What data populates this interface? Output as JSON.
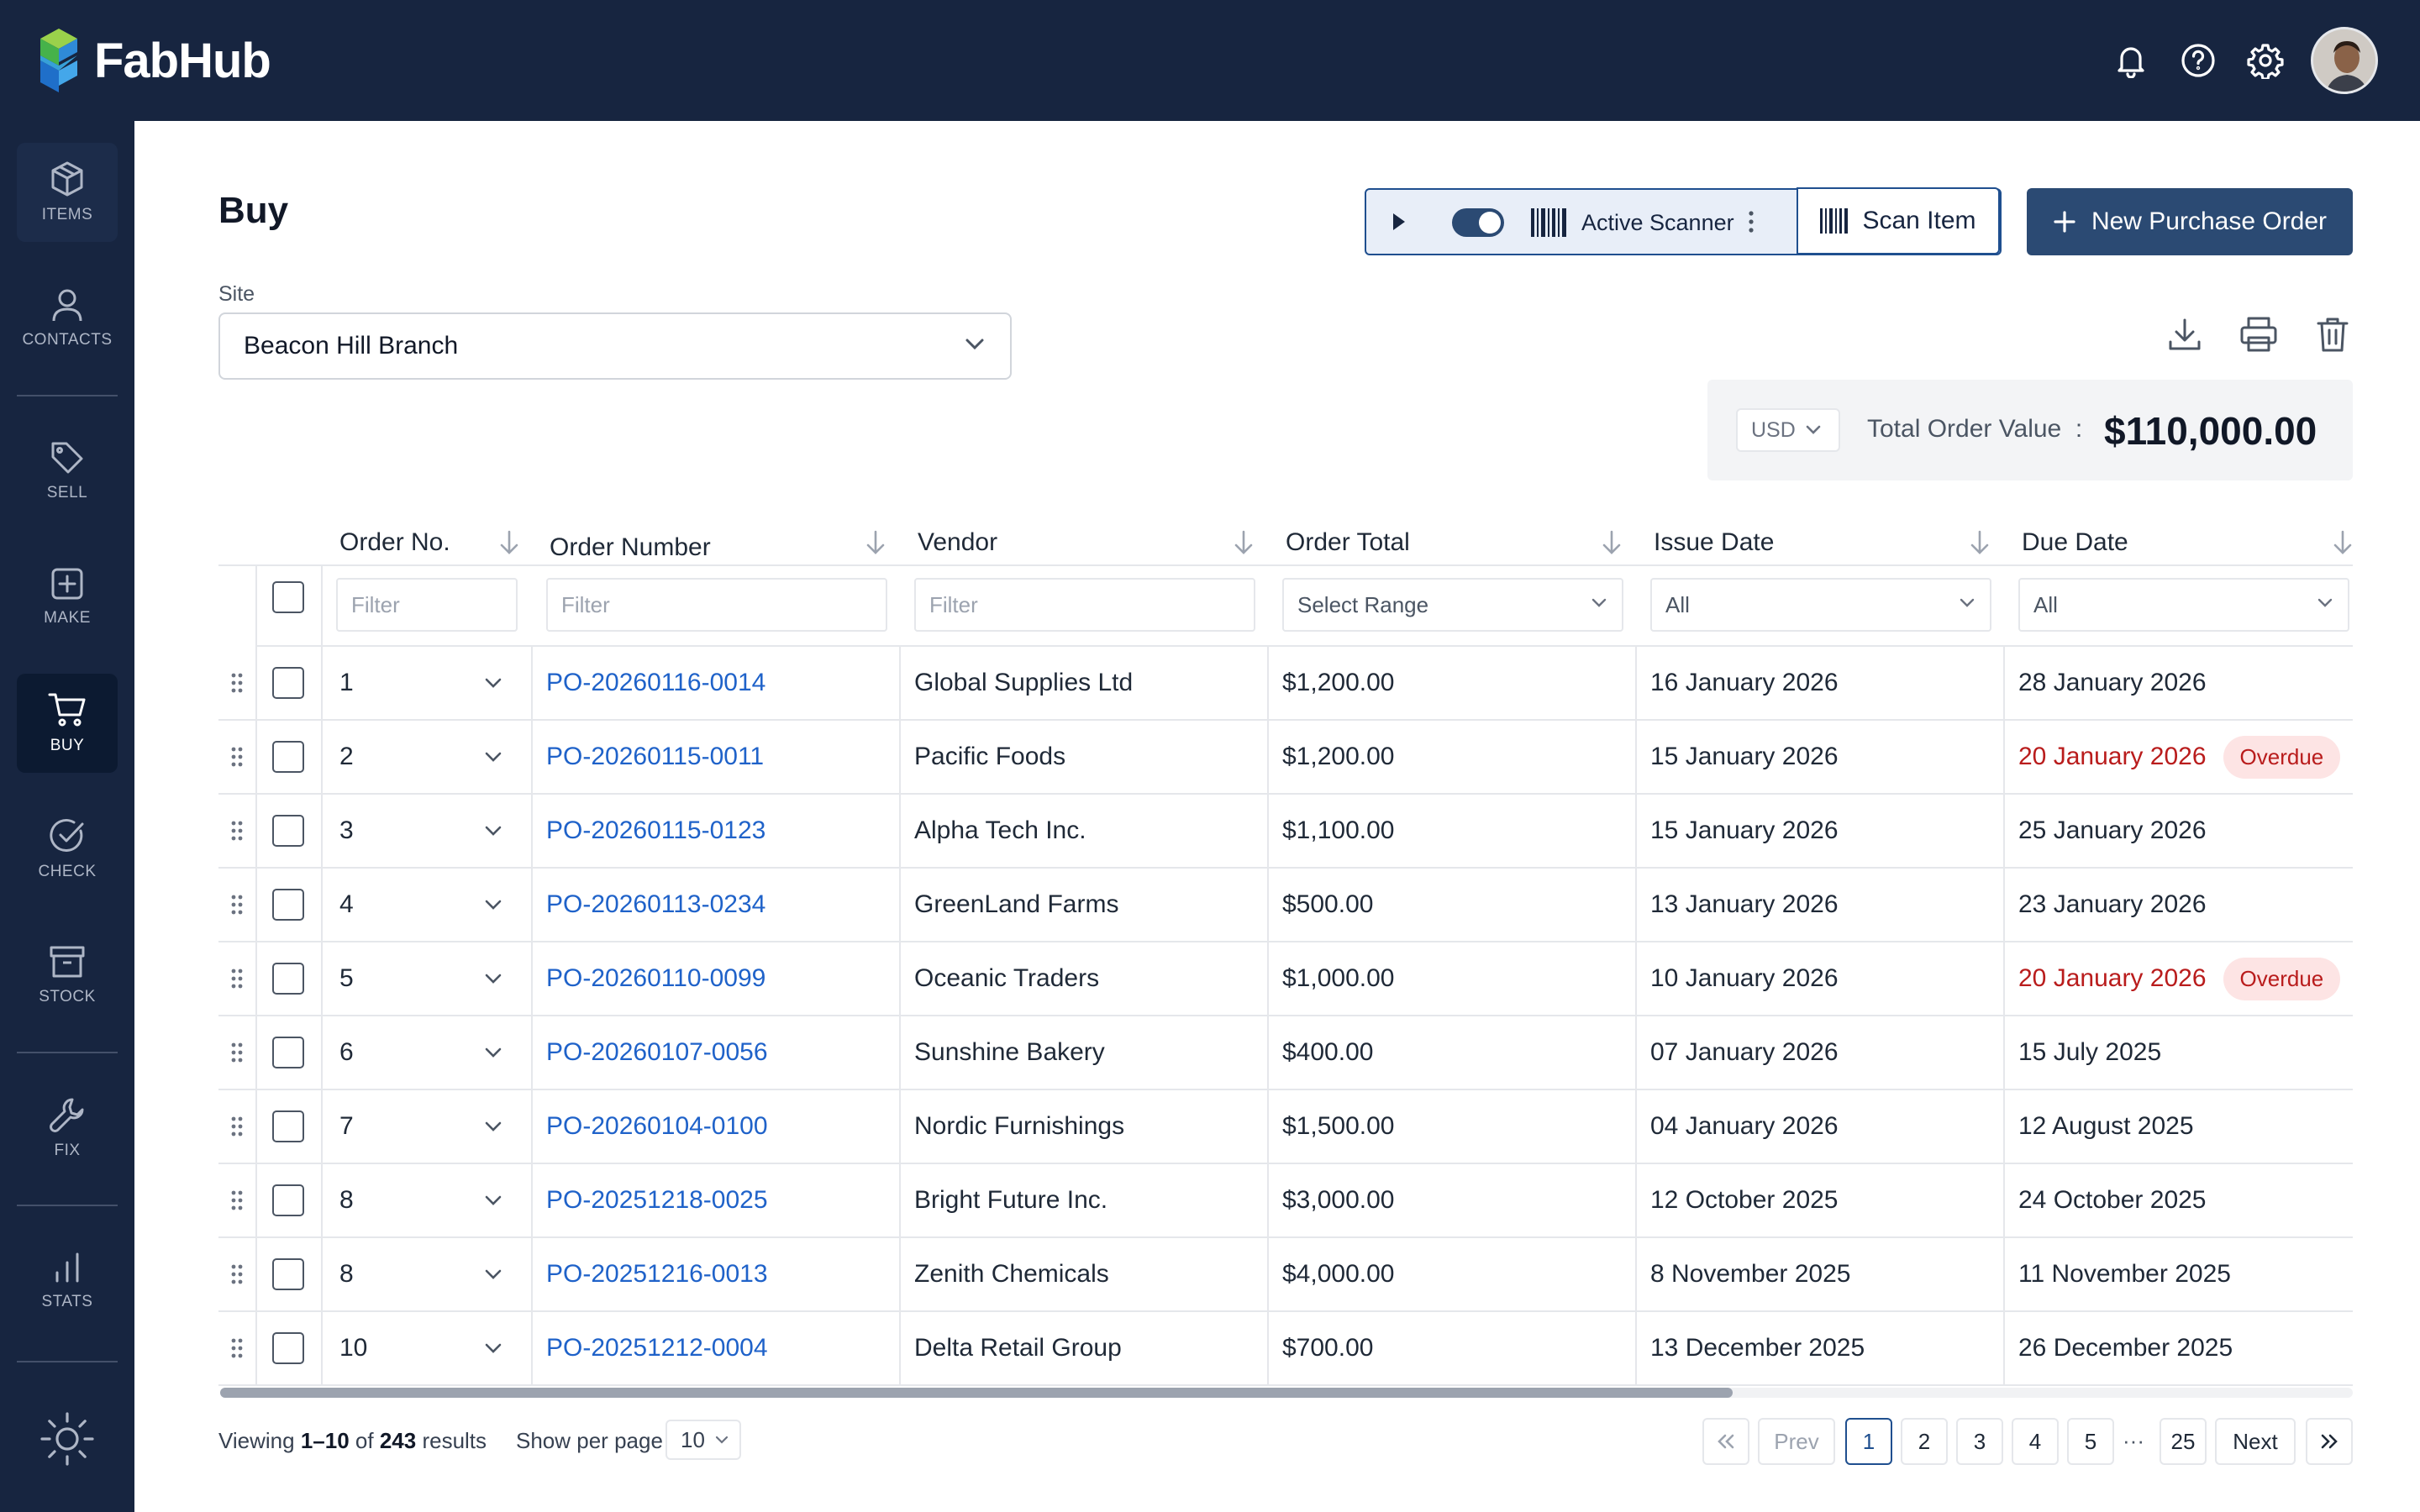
{
  "app": {
    "name": "FabHub"
  },
  "colors": {
    "nav_bg": "#172540",
    "primary": "#2b4a73",
    "link": "#1f62c9",
    "overdue": "#b91c1c",
    "overdue_bg": "#fde4e4"
  },
  "sidebar": {
    "items": [
      {
        "label": "ITEMS",
        "icon": "box-icon"
      },
      {
        "label": "CONTACTS",
        "icon": "person-icon"
      },
      {
        "label": "SELL",
        "icon": "tag-icon"
      },
      {
        "label": "MAKE",
        "icon": "plus-square-icon"
      },
      {
        "label": "BUY",
        "icon": "cart-icon",
        "active": true
      },
      {
        "label": "CHECK",
        "icon": "check-circle-icon"
      },
      {
        "label": "STOCK",
        "icon": "archive-icon"
      },
      {
        "label": "FIX",
        "icon": "wrench-icon"
      },
      {
        "label": "STATS",
        "icon": "bar-chart-icon"
      }
    ],
    "theme_icon": "sun-icon"
  },
  "page": {
    "title": "Buy",
    "site_label": "Site",
    "site_value": "Beacon Hill Branch"
  },
  "toolbar": {
    "scanner_label": "Active Scanner",
    "scanner_enabled": true,
    "scan_item_label": "Scan Item",
    "new_po_label": "New Purchase Order"
  },
  "summary": {
    "currency": "USD",
    "total_label": "Total Order Value",
    "total_separator": ":",
    "total_value": "$110,000.00"
  },
  "table": {
    "columns": [
      "Order No.",
      "Order Number",
      "Vendor",
      "Order Total",
      "Issue Date",
      "Due Date"
    ],
    "filters": {
      "order_number": "Filter",
      "vendor": "Filter",
      "order_no": "Filter",
      "order_total": "Select Range",
      "issue_date": "All",
      "due_date": "All"
    },
    "rows": [
      {
        "no": "1",
        "po": "PO-20260116-0014",
        "vendor": "Global Supplies Ltd",
        "total": "$1,200.00",
        "issue": "16 January 2026",
        "due": "28 January 2026",
        "overdue": false
      },
      {
        "no": "2",
        "po": "PO-20260115-0011",
        "vendor": "Pacific Foods",
        "total": "$1,200.00",
        "issue": "15 January 2026",
        "due": "20 January 2026",
        "overdue": true,
        "badge": "Overdue"
      },
      {
        "no": "3",
        "po": "PO-20260115-0123",
        "vendor": "Alpha Tech Inc.",
        "total": "$1,100.00",
        "issue": "15 January 2026",
        "due": "25 January 2026",
        "overdue": false
      },
      {
        "no": "4",
        "po": "PO-20260113-0234",
        "vendor": "GreenLand Farms",
        "total": "$500.00",
        "issue": "13 January 2026",
        "due": "23 January 2026",
        "overdue": false
      },
      {
        "no": "5",
        "po": "PO-20260110-0099",
        "vendor": "Oceanic Traders",
        "total": "$1,000.00",
        "issue": "10 January 2026",
        "due": "20 January 2026",
        "overdue": true,
        "badge": "Overdue"
      },
      {
        "no": "6",
        "po": "PO-20260107-0056",
        "vendor": "Sunshine Bakery",
        "total": "$400.00",
        "issue": "07 January 2026",
        "due": "15 July 2025",
        "overdue": false
      },
      {
        "no": "7",
        "po": "PO-20260104-0100",
        "vendor": "Nordic Furnishings",
        "total": "$1,500.00",
        "issue": "04 January 2026",
        "due": "12 August 2025",
        "overdue": false
      },
      {
        "no": "8",
        "po": "PO-20251218-0025",
        "vendor": "Bright Future Inc.",
        "total": "$3,000.00",
        "issue": "12 October 2025",
        "due": "24 October 2025",
        "overdue": false
      },
      {
        "no": "8",
        "po": "PO-20251216-0013",
        "vendor": "Zenith Chemicals",
        "total": "$4,000.00",
        "issue": "8 November 2025",
        "due": "11 November 2025",
        "overdue": false
      },
      {
        "no": "10",
        "po": "PO-20251212-0004",
        "vendor": "Delta Retail Group",
        "total": "$700.00",
        "issue": "13 December 2025",
        "due": "26 December 2025",
        "overdue": false
      }
    ]
  },
  "pagination": {
    "viewing_prefix": "Viewing",
    "range": "1–10",
    "of": "of",
    "total": "243",
    "results": "results",
    "per_page_label": "Show per page",
    "per_page": "10",
    "prev": "Prev",
    "next": "Next",
    "pages": [
      "1",
      "2",
      "3",
      "4",
      "5"
    ],
    "ellipsis": "···",
    "last_page": "25",
    "current": "1"
  }
}
